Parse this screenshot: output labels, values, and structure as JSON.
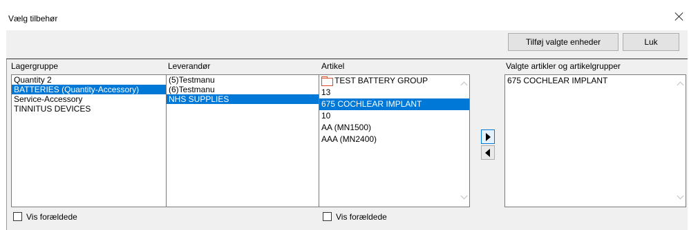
{
  "window": {
    "title": "Vælg tilbehør"
  },
  "toolbar": {
    "add_selected_label": "Tilføj valgte enheder",
    "close_label": "Luk"
  },
  "columns": {
    "lagergruppe": {
      "label": "Lagergruppe",
      "items": [
        {
          "text": "Quantity 2",
          "selected": false
        },
        {
          "text": "BATTERIES (Quantity-Accessory)",
          "selected": true
        },
        {
          "text": "Service-Accessory",
          "selected": false
        },
        {
          "text": "TINNITUS DEVICES",
          "selected": false
        }
      ]
    },
    "leverandor": {
      "label": "Leverandør",
      "items": [
        {
          "text": "(5)Testmanu",
          "selected": false
        },
        {
          "text": "(6)Testmanu",
          "selected": false
        },
        {
          "text": "NHS SUPPLIES",
          "selected": true
        }
      ]
    },
    "artikel": {
      "label": "Artikel",
      "items": [
        {
          "text": "TEST BATTERY GROUP",
          "selected": false,
          "icon": "folder-icon"
        },
        {
          "text": "13",
          "selected": false
        },
        {
          "text": "675 COCHLEAR IMPLANT",
          "selected": true
        },
        {
          "text": "10",
          "selected": false
        },
        {
          "text": "AA (MN1500)",
          "selected": false
        },
        {
          "text": "AAA (MN2400)",
          "selected": false
        }
      ]
    },
    "valgte": {
      "label": "Valgte artikler og artikelgrupper",
      "items": [
        {
          "text": "675 COCHLEAR IMPLANT",
          "selected": false
        }
      ]
    }
  },
  "checkboxes": {
    "vis_foraeldede_1": {
      "label": "Vis forældede",
      "checked": false
    },
    "vis_foraeldede_2": {
      "label": "Vis forældede",
      "checked": false
    }
  },
  "colors": {
    "selection": "#0078d7",
    "folder": "#e2491f",
    "panel_bg": "#f0f0f0"
  }
}
